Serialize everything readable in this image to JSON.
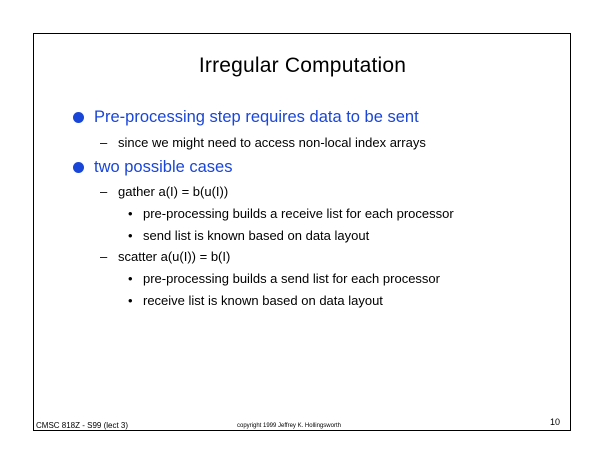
{
  "slide": {
    "title": "Irregular Computation",
    "accent_color": "#1a46d8",
    "bullets": [
      {
        "text": "Pre-processing step requires data to be sent",
        "subitems": [
          {
            "marker": "–",
            "text": "since we might need to access non-local index arrays"
          }
        ]
      },
      {
        "text": "two possible cases",
        "subitems": [
          {
            "marker": "–",
            "text": "gather a(I) = b(u(I))",
            "subitems": [
              {
                "marker": "•",
                "text": "pre-processing builds a receive list for each processor"
              },
              {
                "marker": "•",
                "text": "send list is known based on data layout"
              }
            ]
          },
          {
            "marker": "–",
            "text": "scatter a(u(I)) = b(I)",
            "subitems": [
              {
                "marker": "•",
                "text": "pre-processing builds a send list for each processor"
              },
              {
                "marker": "•",
                "text": "receive list is known based on data layout"
              }
            ]
          }
        ]
      }
    ]
  },
  "footer": {
    "course": "CMSC 818Z - S99  (lect 3)",
    "copyright": "copyright 1999 Jeffrey K. Hollingsworth",
    "page_number": "10"
  }
}
